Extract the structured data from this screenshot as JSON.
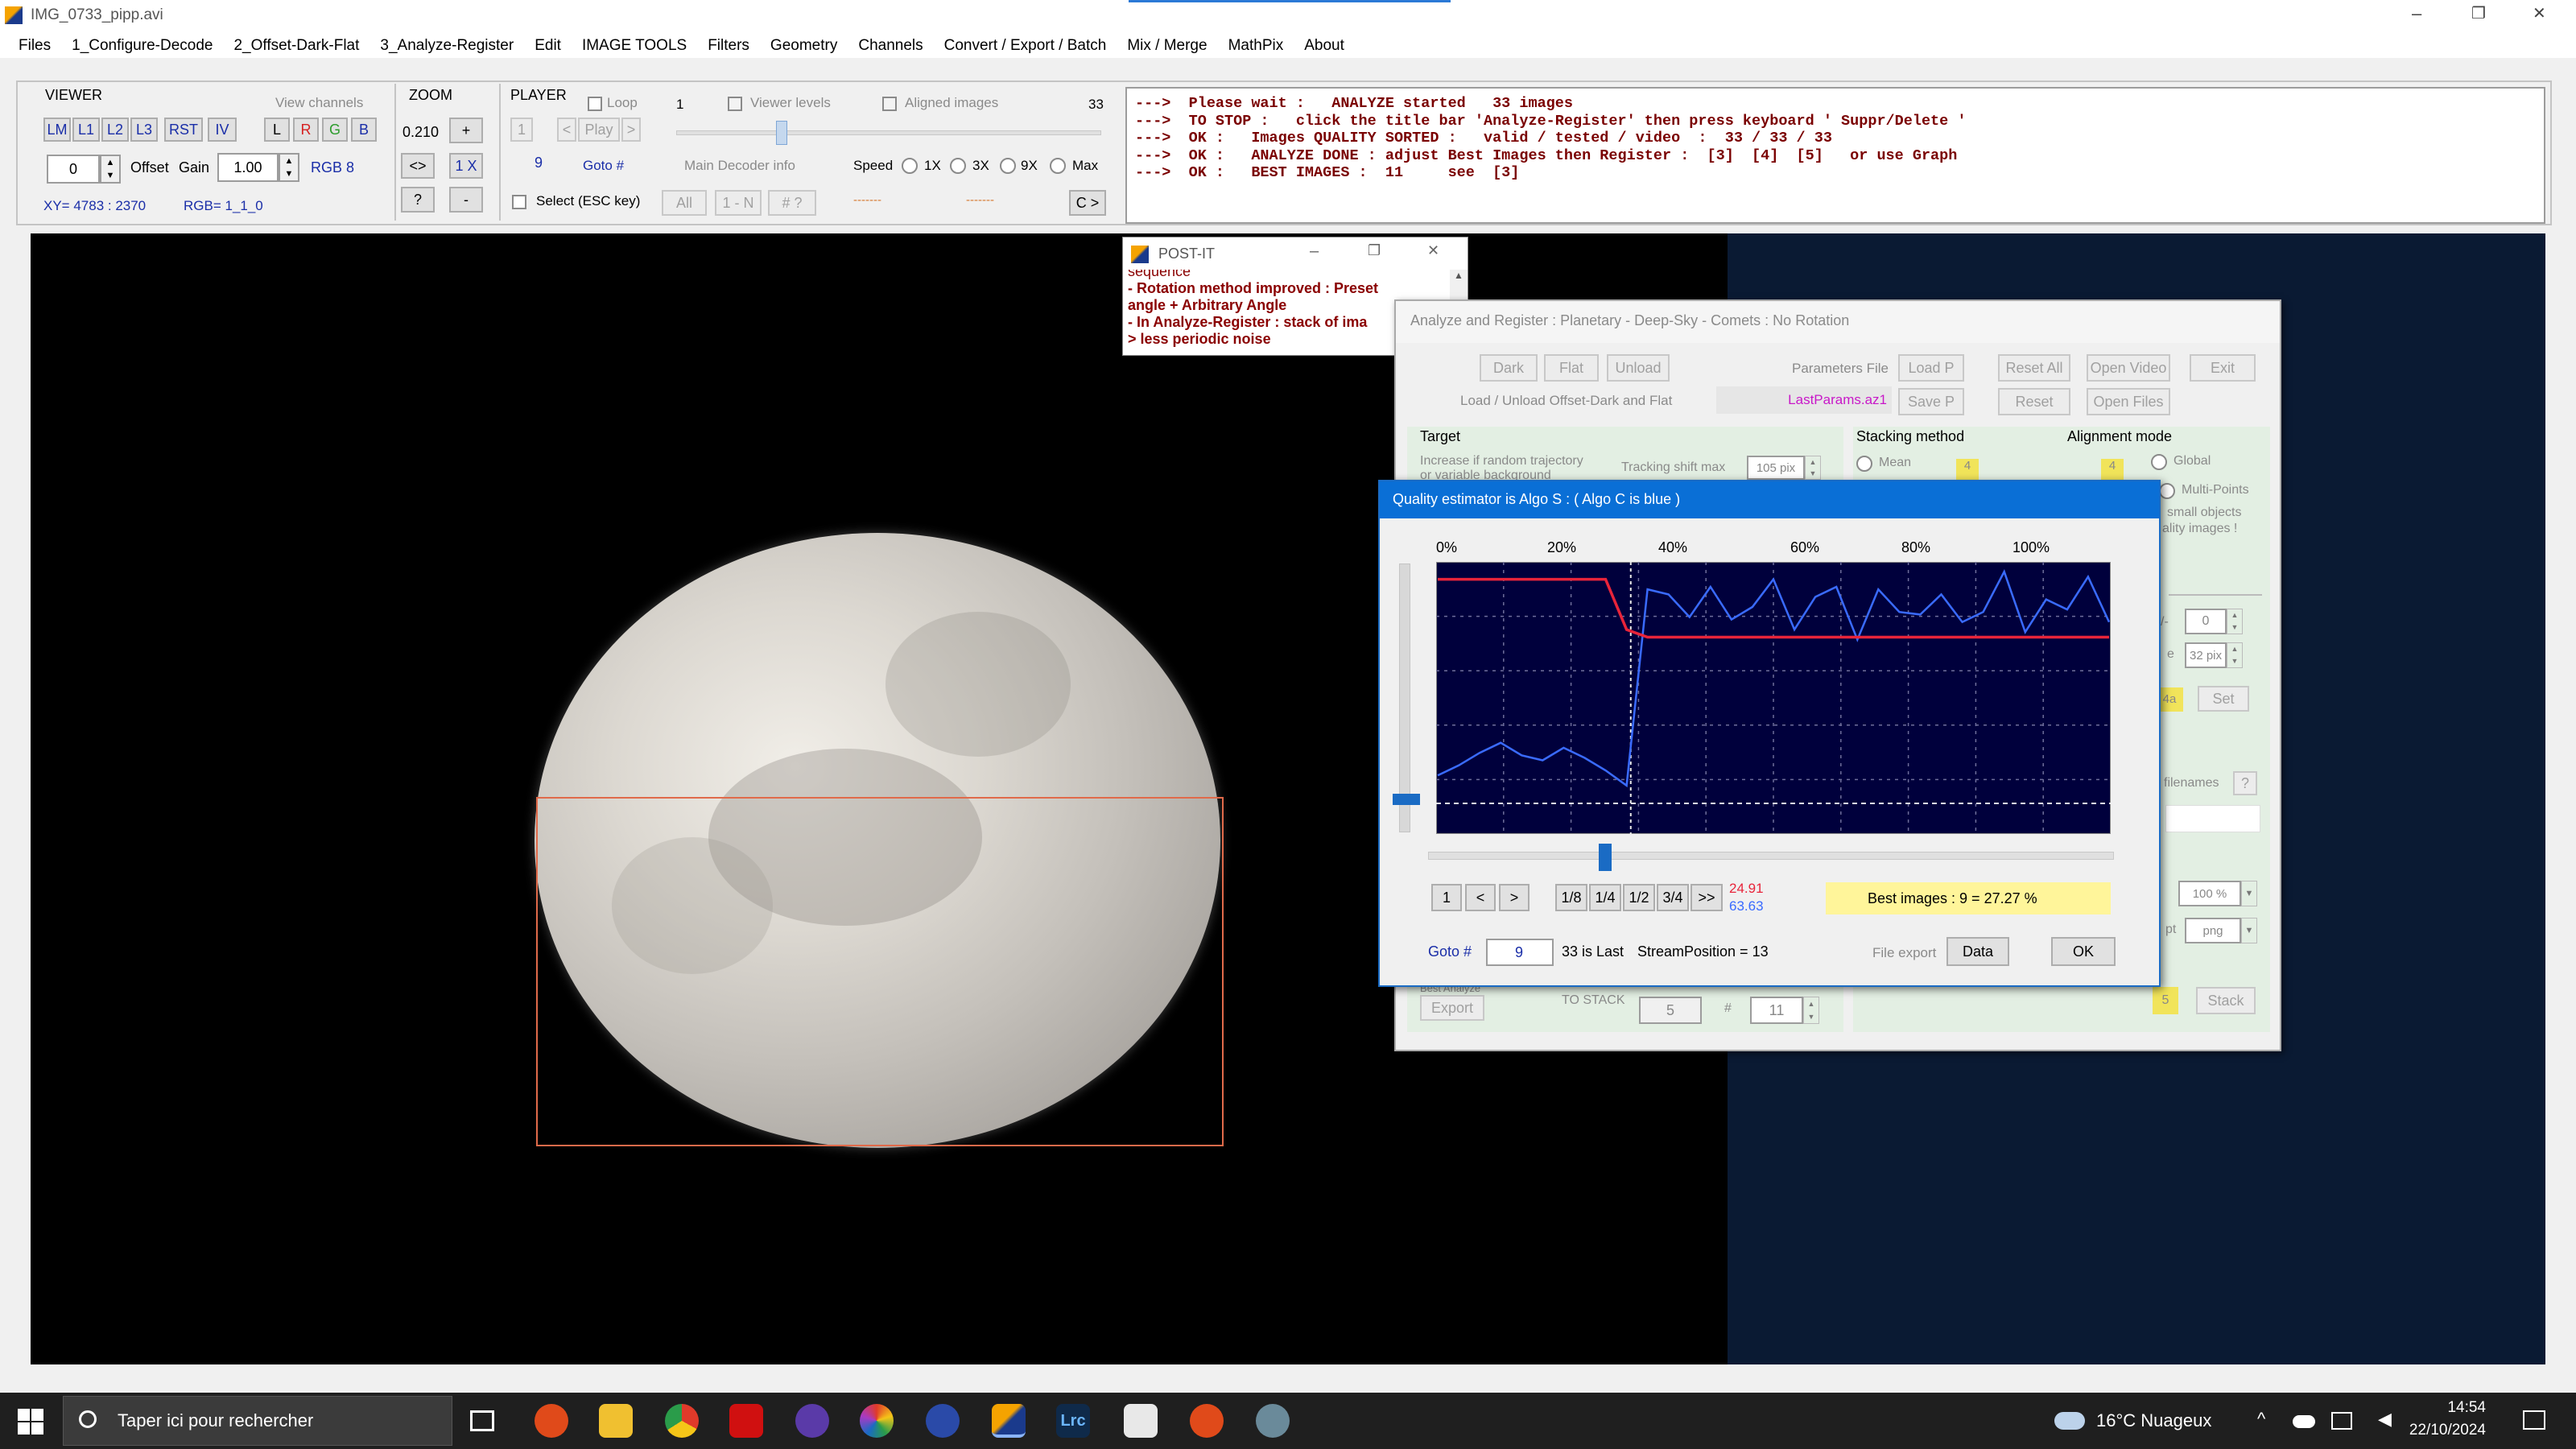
{
  "window": {
    "title": "IMG_0733_pipp.avi",
    "min": "–",
    "max": "❐",
    "close": "✕"
  },
  "menu": [
    "Files",
    "1_Configure-Decode",
    "2_Offset-Dark-Flat",
    "3_Analyze-Register",
    "Edit",
    "IMAGE TOOLS",
    "Filters",
    "Geometry",
    "Channels",
    "Convert / Export / Batch",
    "Mix / Merge",
    "MathPix",
    "About"
  ],
  "viewer_panel": {
    "title": "VIEWER",
    "view_channels": "View channels",
    "buttons": [
      "LM",
      "L1",
      "L2",
      "L3",
      "RST",
      "IV"
    ],
    "channels": [
      "L",
      "R",
      "G",
      "B"
    ],
    "offset_value": "0",
    "offset_label": "Offset",
    "gain_label": "Gain",
    "gain_value": "1.00",
    "rgb_mode": "RGB 8",
    "xy": "XY= 4783 : 2370",
    "rgb": "RGB= 1_1_0"
  },
  "zoom_panel": {
    "title": "ZOOM",
    "value": "0.210",
    "plus": "+",
    "fit": "<>",
    "one": "1 X",
    "help": "?",
    "minus": "-"
  },
  "player_panel": {
    "title": "PLAYER",
    "loop": "Loop",
    "frame": "1",
    "viewer_levels": "Viewer levels",
    "aligned": "Aligned images",
    "total": "33",
    "first": "1",
    "prev": "<",
    "play": "Play",
    "next": ">",
    "goto_value": "9",
    "goto": "Goto #",
    "decoder_info": "Main Decoder info",
    "speed": "Speed",
    "s1": "1X",
    "s3": "3X",
    "s9": "9X",
    "smax": "Max",
    "select": "Select  (ESC key)",
    "all": "All",
    "one_n": "1 - N",
    "num": "# ?",
    "dash1": "-------",
    "dash2": "-------",
    "c": "C >"
  },
  "console": [
    "--->  Please wait :   ANALYZE started   33 images",
    "--->  TO STOP :   click the title bar 'Analyze-Register' then press keyboard ' Suppr/Delete '",
    "--->  OK :   Images QUALITY SORTED :   valid / tested / video  :  33 / 33 / 33",
    "--->  OK :   ANALYZE DONE : adjust Best Images then Register :  [3]  [4]  [5]   or use Graph",
    "--->  OK :   BEST IMAGES :  11     see  [3]"
  ],
  "postit": {
    "title": "POST-IT",
    "lines": [
      "sequence",
      "- Rotation method improved : Preset",
      "angle + Arbitrary Angle",
      "- In Analyze-Register : stack of ima",
      "> less periodic noise"
    ]
  },
  "analyze": {
    "title": "Analyze and Register :   Planetary - Deep-Sky - Comets  :   No Rotation",
    "dark": "Dark",
    "flat": "Flat",
    "unload": "Unload",
    "params_file": "Parameters File",
    "load_p": "Load P",
    "reset_all": "Reset All",
    "open_video": "Open Video",
    "exit": "Exit",
    "load_unload": "Load / Unload Offset-Dark and Flat",
    "last_params": "LastParams.az1",
    "save_p": "Save P",
    "reset": "Reset",
    "open_files": "Open Files",
    "target": "Target",
    "increase": "Increase if random trajectory",
    "hint2": "or variable background",
    "tracking": "Tracking shift max",
    "tracking_val": "105 pix",
    "stacking": "Stacking method",
    "mean": "Mean",
    "alignment": "Alignment mode",
    "global": "Global",
    "multi": "Multi-Points",
    "small": "small objects",
    "quality": "ality images !",
    "v0": "0",
    "v32": "32 pix",
    "set": "Set",
    "filenames": "filenames",
    "q": "?",
    "pct": "100 %",
    "png": "png",
    "export_grp": "Best Analyze",
    "export": "Export",
    "to_stack": "TO STACK",
    "stack5": "5",
    "hash": "#",
    "stack11": "11",
    "five": "5",
    "stack": "Stack",
    "four": "4",
    "ga": "4a",
    "minus_lbl": "/-",
    "e_lbl": "e",
    "p_lbl": "pt"
  },
  "quality": {
    "title": "Quality estimator is Algo S :  ( Algo C is blue )",
    "ticks": [
      "0%",
      "20%",
      "40%",
      "60%",
      "80%",
      "100%"
    ],
    "b1": "1",
    "b_prev": "<",
    "b_next": ">",
    "f18": "1/8",
    "f14": "1/4",
    "f12": "1/2",
    "f34": "3/4",
    "fend": ">>",
    "v1": "24.91",
    "v2": "63.63",
    "best": "Best images :    9 =  27.27 %",
    "goto": "Goto #",
    "goto_val": "9",
    "last": "33 is Last",
    "stream": "StreamPosition = 13",
    "file_export": "File export",
    "data": "Data",
    "ok": "OK"
  },
  "chart_data": {
    "type": "line",
    "xlim": [
      1,
      33
    ],
    "series": [
      {
        "name": "Algo C",
        "color": "#3a6bff",
        "x": [
          1,
          2,
          3,
          4,
          5,
          6,
          7,
          8,
          9,
          10,
          11,
          12,
          13,
          14,
          15,
          16,
          17,
          18,
          19,
          20,
          21,
          22,
          23,
          24,
          25,
          26,
          27,
          28,
          29,
          30,
          31,
          32,
          33
        ],
        "y": [
          22,
          26,
          31,
          35,
          30,
          28,
          33,
          29,
          24,
          18,
          96,
          94,
          85,
          97,
          84,
          89,
          100,
          80,
          93,
          97,
          76,
          96,
          87,
          86,
          94,
          83,
          87,
          103,
          79,
          92,
          88,
          101,
          83
        ]
      },
      {
        "name": "Algo S",
        "color": "#e8243a",
        "x": [
          1,
          2,
          3,
          4,
          5,
          6,
          7,
          8,
          9,
          10,
          11,
          12,
          13,
          14,
          15,
          16,
          17,
          18,
          19,
          20,
          21,
          22,
          23,
          24,
          25,
          26,
          27,
          28,
          29,
          30,
          31,
          32,
          33
        ],
        "y": [
          100,
          100,
          100,
          100,
          100,
          100,
          100,
          100,
          100,
          80,
          77,
          77,
          77,
          77,
          77,
          77,
          77,
          77,
          77,
          77,
          77,
          77,
          77,
          77,
          77,
          77,
          77,
          77,
          77,
          77,
          77,
          77,
          77
        ]
      }
    ],
    "ylim": [
      0,
      105
    ],
    "grid": true
  },
  "taskbar": {
    "search": "Taper ici pour rechercher",
    "weather": "16°C  Nuageux",
    "time": "14:54",
    "date": "22/10/2024",
    "lrc": "Lrc"
  }
}
